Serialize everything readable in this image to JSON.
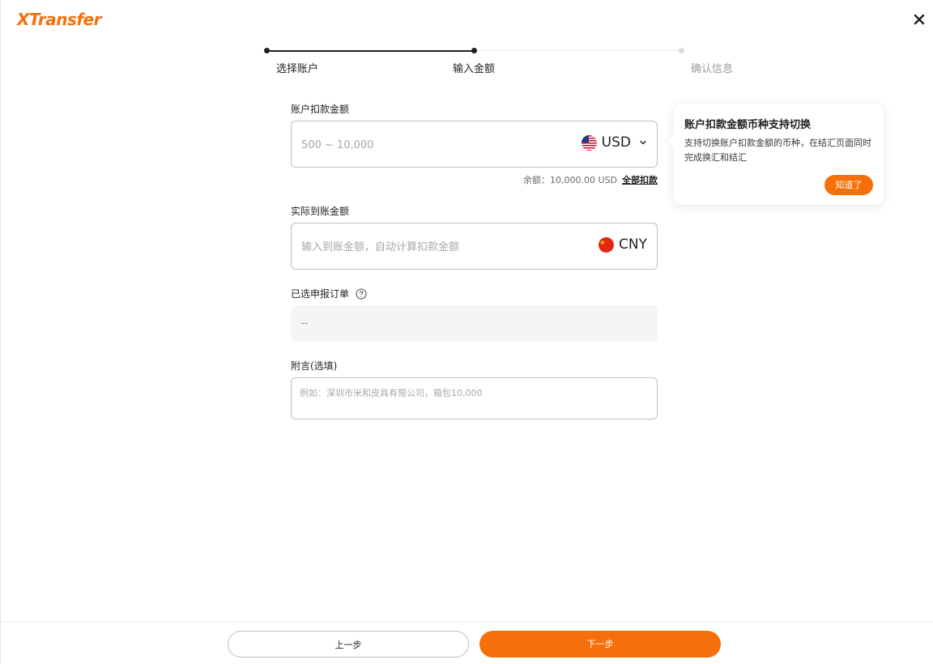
{
  "header": {
    "logo_text": "XTransfer",
    "close_icon": "close-icon"
  },
  "stepper": {
    "steps": [
      {
        "label": "选择账户",
        "state": "done"
      },
      {
        "label": "输入金额",
        "state": "current"
      },
      {
        "label": "确认信息",
        "state": "todo"
      }
    ]
  },
  "form": {
    "debit": {
      "label": "账户扣款金额",
      "placeholder": "500 ~ 10,000",
      "currency": "USD",
      "flag_icon": "us-flag-icon"
    },
    "balance": {
      "text": "余额：10,000.00 USD",
      "all_link": "全部扣款"
    },
    "credit": {
      "label": "实际到账金额",
      "placeholder": "输入到账金额，自动计算扣款金额",
      "currency": "CNY",
      "flag_icon": "china-flag-icon"
    },
    "orders": {
      "label": "已选申报订单",
      "value": "--"
    },
    "note": {
      "label": "附言(选填)",
      "placeholder": "例如：深圳市米和皮具有限公司，箱包10,000"
    }
  },
  "tooltip": {
    "title": "账户扣款金额币种支持切换",
    "body": "支持切换账户扣款金额的币种，在结汇页面同时完成换汇和结汇",
    "button": "知道了"
  },
  "footer": {
    "prev_label": "上一步",
    "next_label": "下一步"
  },
  "colors": {
    "accent": "#f5700a",
    "text": "#1f1f1f",
    "muted": "#a8a8a8"
  }
}
